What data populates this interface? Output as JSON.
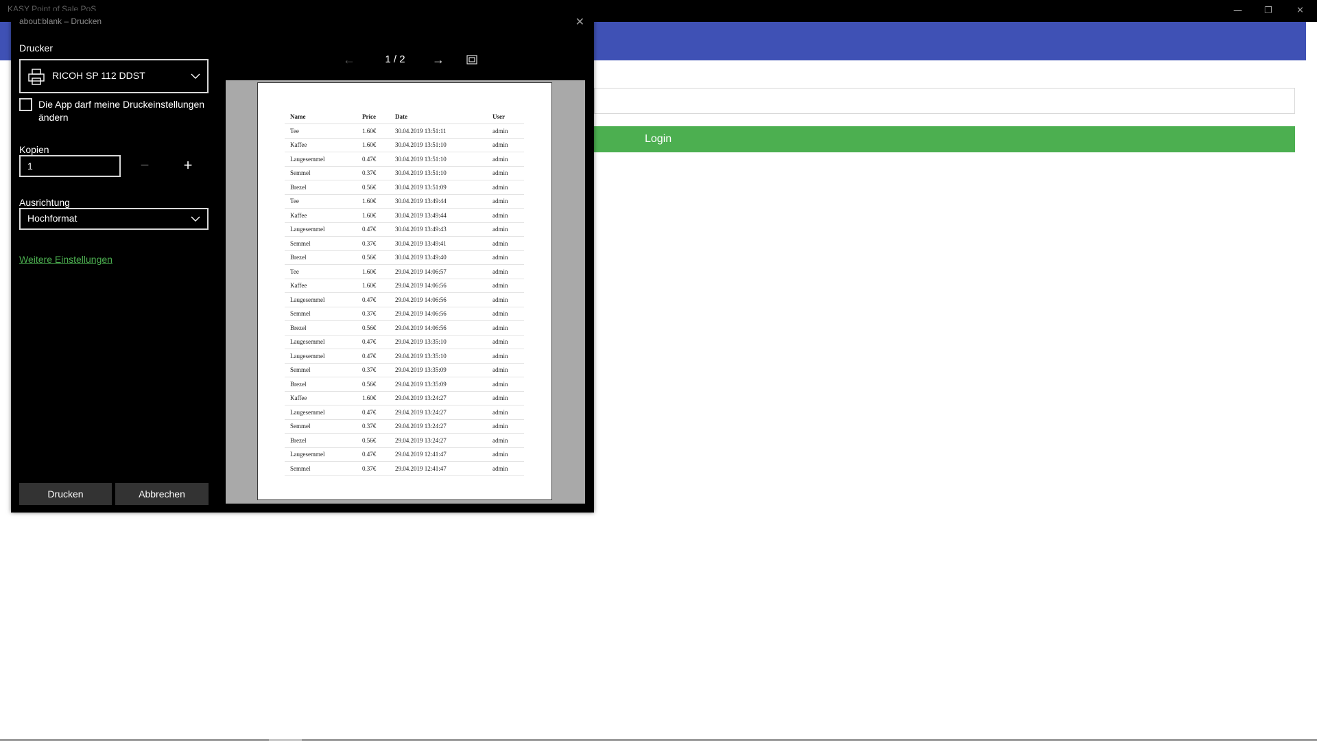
{
  "app": {
    "title": "KASY Point of Sale PoS",
    "login_label": "Login"
  },
  "window_controls": {
    "minimize": "—",
    "restore": "❐",
    "close": "✕"
  },
  "dialog": {
    "title": "about:blank – Drucken",
    "printer_label": "Drucker",
    "printer_value": "RICOH SP 112 DDST",
    "checkbox_label": "Die App darf meine Druckeinstellungen ändern",
    "copies_label": "Kopien",
    "copies_value": "1",
    "minus": "−",
    "plus": "+",
    "orientation_label": "Ausrichtung",
    "orientation_value": "Hochformat",
    "more_settings": "Weitere Einstellungen",
    "print_button": "Drucken",
    "cancel_button": "Abbrechen",
    "page_indicator": "1 / 2"
  },
  "preview": {
    "headers": [
      "Name",
      "Price",
      "Date",
      "User"
    ],
    "rows": [
      [
        "Tee",
        "1.60€",
        "30.04.2019 13:51:11",
        "admin"
      ],
      [
        "Kaffee",
        "1.60€",
        "30.04.2019 13:51:10",
        "admin"
      ],
      [
        "Laugesemmel",
        "0.47€",
        "30.04.2019 13:51:10",
        "admin"
      ],
      [
        "Semmel",
        "0.37€",
        "30.04.2019 13:51:10",
        "admin"
      ],
      [
        "Brezel",
        "0.56€",
        "30.04.2019 13:51:09",
        "admin"
      ],
      [
        "Tee",
        "1.60€",
        "30.04.2019 13:49:44",
        "admin"
      ],
      [
        "Kaffee",
        "1.60€",
        "30.04.2019 13:49:44",
        "admin"
      ],
      [
        "Laugesemmel",
        "0.47€",
        "30.04.2019 13:49:43",
        "admin"
      ],
      [
        "Semmel",
        "0.37€",
        "30.04.2019 13:49:41",
        "admin"
      ],
      [
        "Brezel",
        "0.56€",
        "30.04.2019 13:49:40",
        "admin"
      ],
      [
        "Tee",
        "1.60€",
        "29.04.2019 14:06:57",
        "admin"
      ],
      [
        "Kaffee",
        "1.60€",
        "29.04.2019 14:06:56",
        "admin"
      ],
      [
        "Laugesemmel",
        "0.47€",
        "29.04.2019 14:06:56",
        "admin"
      ],
      [
        "Semmel",
        "0.37€",
        "29.04.2019 14:06:56",
        "admin"
      ],
      [
        "Brezel",
        "0.56€",
        "29.04.2019 14:06:56",
        "admin"
      ],
      [
        "Laugesemmel",
        "0.47€",
        "29.04.2019 13:35:10",
        "admin"
      ],
      [
        "Laugesemmel",
        "0.47€",
        "29.04.2019 13:35:10",
        "admin"
      ],
      [
        "Semmel",
        "0.37€",
        "29.04.2019 13:35:09",
        "admin"
      ],
      [
        "Brezel",
        "0.56€",
        "29.04.2019 13:35:09",
        "admin"
      ],
      [
        "Kaffee",
        "1.60€",
        "29.04.2019 13:24:27",
        "admin"
      ],
      [
        "Laugesemmel",
        "0.47€",
        "29.04.2019 13:24:27",
        "admin"
      ],
      [
        "Semmel",
        "0.37€",
        "29.04.2019 13:24:27",
        "admin"
      ],
      [
        "Brezel",
        "0.56€",
        "29.04.2019 13:24:27",
        "admin"
      ],
      [
        "Laugesemmel",
        "0.47€",
        "29.04.2019 12:41:47",
        "admin"
      ],
      [
        "Semmel",
        "0.37€",
        "29.04.2019 12:41:47",
        "admin"
      ]
    ]
  },
  "colors": {
    "header_blue": "#3f51b5",
    "login_green": "#4caf50",
    "link_green": "#4caf50"
  },
  "icons": {
    "printer": "printer-icon",
    "prev": "arrow-left-icon",
    "next": "arrow-right-icon",
    "fit": "fit-page-icon",
    "dropdown": "chevron-down-icon",
    "close": "close-icon"
  }
}
